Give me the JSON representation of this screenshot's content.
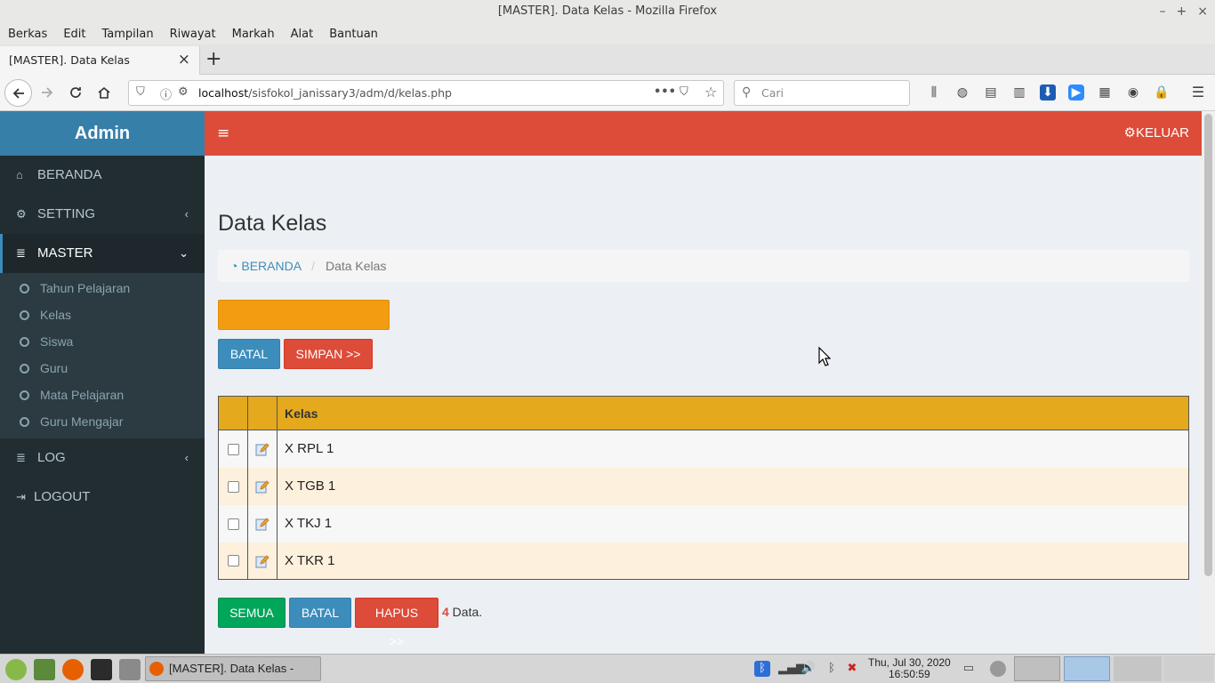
{
  "window": {
    "title": "[MASTER]. Data Kelas - Mozilla Firefox",
    "controls": [
      "–",
      "+",
      "×"
    ]
  },
  "menubar": [
    "Berkas",
    "Edit",
    "Tampilan",
    "Riwayat",
    "Markah",
    "Alat",
    "Bantuan"
  ],
  "tab": {
    "title": "[MASTER]. Data Kelas",
    "close": "×",
    "new_tab": "+"
  },
  "navbar": {
    "url_host": "localhost",
    "url_path": "/sisfokol_janissary3/adm/d/kelas.php",
    "search_placeholder": "Cari"
  },
  "sidebar": {
    "logo": "Admin",
    "items": [
      {
        "label": "BERANDA",
        "icon": "home-icon"
      },
      {
        "label": "SETTING",
        "icon": "cogs-icon",
        "arrow": "‹"
      },
      {
        "label": "MASTER",
        "icon": "database-icon",
        "arrow": "⌄",
        "active": true
      },
      {
        "label": "LOG",
        "icon": "database-icon",
        "arrow": "‹"
      },
      {
        "label": "LOGOUT",
        "icon": "sign-out-icon"
      }
    ],
    "submenu": [
      "Tahun Pelajaran",
      "Kelas",
      "Siswa",
      "Guru",
      "Mata Pelajaran",
      "Guru Mengajar"
    ]
  },
  "header": {
    "hamburger": "≡",
    "logout_label": "KELUAR"
  },
  "content": {
    "page_title": "Data Kelas",
    "breadcrumb_home": "BERANDA",
    "breadcrumb_current": "Data Kelas",
    "form": {
      "input_value": "",
      "cancel_label": "BATAL",
      "save_label": "SIMPAN >>"
    },
    "table": {
      "headers": [
        "",
        "",
        "Kelas"
      ],
      "rows": [
        "X RPL 1",
        "X TGB 1",
        "X TKJ 1",
        "X TKR 1"
      ]
    },
    "actions": {
      "all_label": "SEMUA",
      "cancel_label": "BATAL",
      "delete_label": "HAPUS >>"
    },
    "count": "4",
    "count_suffix": " Data."
  },
  "taskbar": {
    "task_title": "[MASTER]. Data Kelas - Mozi...",
    "clock_date": "Thu, Jul 30, 2020",
    "clock_time": "16:50:59"
  },
  "colors": {
    "header": "#dd4b39",
    "logo": "#367fa9",
    "sidebar": "#222d32",
    "input": "#f39c12",
    "table_header": "#e5a91e",
    "blue_button": "#3c8dbc",
    "red_button": "#dd4b39",
    "green_button": "#00a65a"
  }
}
